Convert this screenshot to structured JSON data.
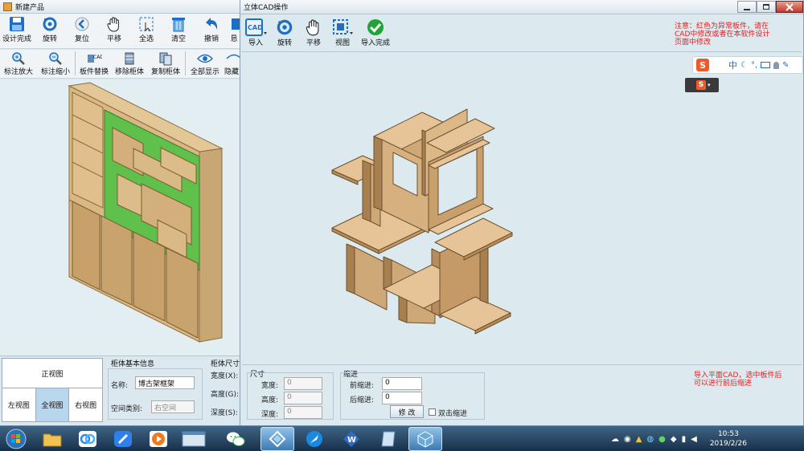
{
  "left_window": {
    "title": "新建产品",
    "toolbar1": [
      {
        "label": "设计完成",
        "icon": "save-icon"
      },
      {
        "label": "旋转",
        "icon": "rotate-icon"
      },
      {
        "label": "复位",
        "icon": "reset-icon"
      },
      {
        "label": "平移",
        "icon": "hand-icon"
      },
      {
        "label": "全选",
        "icon": "select-all-icon"
      },
      {
        "label": "清空",
        "icon": "trash-icon"
      },
      {
        "label": "撤销",
        "icon": "undo-icon"
      },
      {
        "label": "恳"
      }
    ],
    "toolbar2": [
      {
        "label": "标注放大",
        "icon": "zoom-in-icon"
      },
      {
        "label": "标注缩小",
        "icon": "zoom-out-icon"
      },
      {
        "label": "板件替换",
        "icon": "cad-replace-icon",
        "badge": "CAD"
      },
      {
        "label": "移除柜体",
        "icon": "remove-cabinet-icon"
      },
      {
        "label": "复制柜体",
        "icon": "copy-cabinet-icon"
      },
      {
        "label": "全部显示",
        "icon": "eye-icon"
      },
      {
        "label": "隐藏",
        "icon": "hide-icon"
      }
    ],
    "views": {
      "front": "正视图",
      "left": "左视图",
      "all": "全视图",
      "right": "右视图"
    },
    "basic_info": {
      "title": "柜体基本信息",
      "name_label": "名称:",
      "name_value": "博古架框架",
      "space_label": "空间类别:",
      "space_value": "右空间"
    },
    "size_info": {
      "title": "柜体尺寸",
      "width_label": "宽度(X):",
      "height_label": "高度(G):",
      "depth_label": "深度(S):"
    }
  },
  "cad_window": {
    "title": "立体CAD操作",
    "toolbar": [
      {
        "label": "导入",
        "icon": "cad-import-icon",
        "badge": "CAD"
      },
      {
        "label": "旋转",
        "icon": "rotate-icon"
      },
      {
        "label": "平移",
        "icon": "hand-icon"
      },
      {
        "label": "视图",
        "icon": "view-icon"
      },
      {
        "label": "导入完成",
        "icon": "check-icon"
      }
    ],
    "note_top": "注意：红色为异常板件，请在CAD中修改或者在本软件设计页面中修改",
    "note_bottom": "导入平面CAD，选中板件后可以进行前后缩进",
    "size_group": {
      "title": "尺寸",
      "width_label": "宽度:",
      "height_label": "高度:",
      "depth_label": "深度:",
      "width": "0",
      "height": "0",
      "depth": "0"
    },
    "indent_group": {
      "title": "缩进",
      "front_label": "前缩进:",
      "back_label": "后缩进:",
      "front": "0",
      "back": "0",
      "modify_button": "修 改",
      "double_click_label": "双击缩进"
    }
  },
  "ime": {
    "lang": "中",
    "logo": "S"
  },
  "taskbar": {
    "time": "10:53",
    "date": "2019/2/26",
    "apps": [
      "folder-icon",
      "baidu-netdisk-icon",
      "feishu-icon",
      "media-player-icon",
      "app-window-icon",
      "wechat-icon",
      "diamond-app-icon",
      "feather-app-icon",
      "w-app-icon",
      "document-app-icon",
      "cube-app-icon"
    ]
  },
  "colors": {
    "wood": "#dcb98a",
    "wood_dark": "#b9925e",
    "green": "#5fc04c",
    "panel_bg": "#dce9ee",
    "red": "#e32020",
    "taskbar": "#1b3856"
  }
}
